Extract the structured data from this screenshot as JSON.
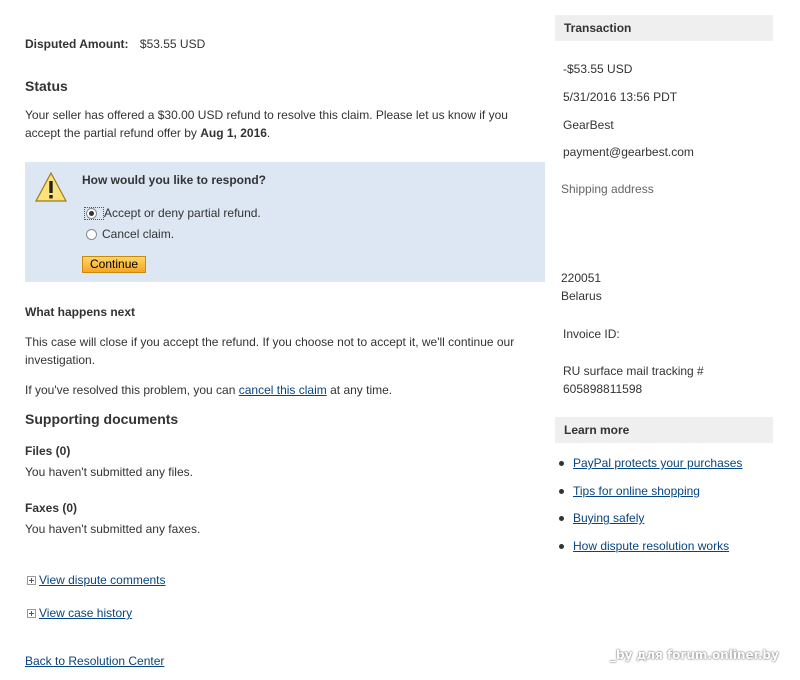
{
  "dispute": {
    "amount_label": "Disputed Amount:",
    "amount_value": "$53.55 USD"
  },
  "status": {
    "heading": "Status",
    "text_before": "Your seller has offered a $30.00 USD refund to resolve this claim. Please let us know if you accept the partial refund offer by ",
    "deadline": "Aug 1, 2016",
    "text_after": "."
  },
  "respond": {
    "question": "How would you like to respond?",
    "options": [
      {
        "label": "Accept or deny partial refund.",
        "selected": true
      },
      {
        "label": "Cancel claim.",
        "selected": false
      }
    ],
    "continue_label": "Continue"
  },
  "next": {
    "heading": "What happens next",
    "text": "This case will close if you accept the refund. If you choose not to accept it, we'll continue our investigation.",
    "resolved_before": "If you've resolved this problem, you can ",
    "cancel_link": "cancel this claim",
    "resolved_after": " at any time."
  },
  "support": {
    "heading": "Supporting documents",
    "files_heading": "Files (0)",
    "files_text": "You haven't submitted any files.",
    "faxes_heading": "Faxes (0)",
    "faxes_text": "You haven't submitted any faxes.",
    "view_comments": "View dispute comments",
    "view_history": "View case history"
  },
  "back_link": "Back to Resolution Center",
  "transaction": {
    "heading": "Transaction",
    "amount": "-$53.55 USD",
    "datetime": "5/31/2016 13:56 PDT",
    "merchant": "GearBest",
    "email": "payment@gearbest.com",
    "shipping_label": "Shipping address",
    "postal_code": "220051",
    "country": "Belarus",
    "invoice_label": "Invoice ID:",
    "tracking_label": "RU surface mail tracking #",
    "tracking_number": "605898811598"
  },
  "learn_more": {
    "heading": "Learn more",
    "links": [
      "PayPal protects your purchases",
      "Tips for online shopping",
      "Buying safely",
      "How dispute resolution works"
    ]
  },
  "watermark": "_by для forum.onliner.by",
  "colors": {
    "box_bg": "#dce7f3",
    "link": "#084482",
    "button": "#f5a623",
    "side_head_bg": "#efefef"
  }
}
